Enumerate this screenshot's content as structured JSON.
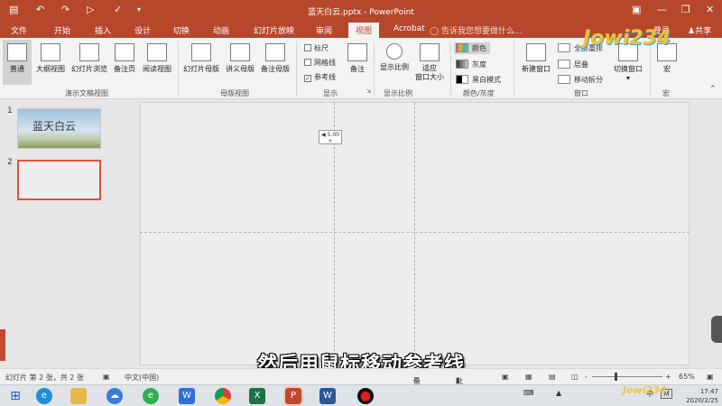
{
  "window": {
    "title": "蓝天白云.pptx - PowerPoint"
  },
  "tabs": [
    "文件",
    "开始",
    "插入",
    "设计",
    "切换",
    "动画",
    "幻灯片放映",
    "审阅",
    "视图",
    "Acrobat"
  ],
  "tell_me": "告诉我您想要做什么...",
  "login": "登录",
  "share": "共享",
  "ribbon": {
    "normal": "普通",
    "outline": "大纲视图",
    "slide_sorter": "幻灯片浏览",
    "notes_page": "备注页",
    "reading_view": "阅读视图",
    "group_presentation_views": "演示文稿视图",
    "slide_master": "幻灯片母版",
    "handout_master": "讲义母版",
    "notes_master": "备注母版",
    "group_master_views": "母版视图",
    "ruler": "标尺",
    "gridlines": "网格线",
    "guides": "参考线",
    "notes": "备注",
    "group_show": "显示",
    "zoom": "显示比例",
    "fit_to_window": "适应\n窗口大小",
    "group_zoom": "显示比例",
    "color": "颜色",
    "grayscale": "灰度",
    "black_white": "黑白模式",
    "group_color": "颜色/灰度",
    "new_window": "新建窗口",
    "arrange_all": "全部重排",
    "cascade": "层叠",
    "move_split": "移动拆分",
    "switch_windows": "切换窗口",
    "group_window": "窗口",
    "macros": "宏",
    "group_macros": "宏"
  },
  "slides": [
    {
      "number": "1",
      "text": "蓝天白云"
    },
    {
      "number": "2",
      "text": ""
    }
  ],
  "guide_tooltip": {
    "value": "5.00",
    "sign": "+"
  },
  "subtitle": "然后用鼠标移动参考线",
  "status": {
    "slide_info": "幻灯片 第 2 张，共 2 张",
    "language": "中文(中国)",
    "notes": "备注",
    "comments": "批注",
    "zoom_minus": "-",
    "zoom_plus": "+",
    "zoom": "65%"
  },
  "taskbar": {
    "ime": "中",
    "ime_mode": "M",
    "time": "17:47",
    "date": "2020/2/25"
  },
  "watermark": "Jowi234",
  "colors": {
    "accent": "#b7472a",
    "ribbon_bg": "#f3f3f3",
    "slide_selected": "#d6553a"
  }
}
